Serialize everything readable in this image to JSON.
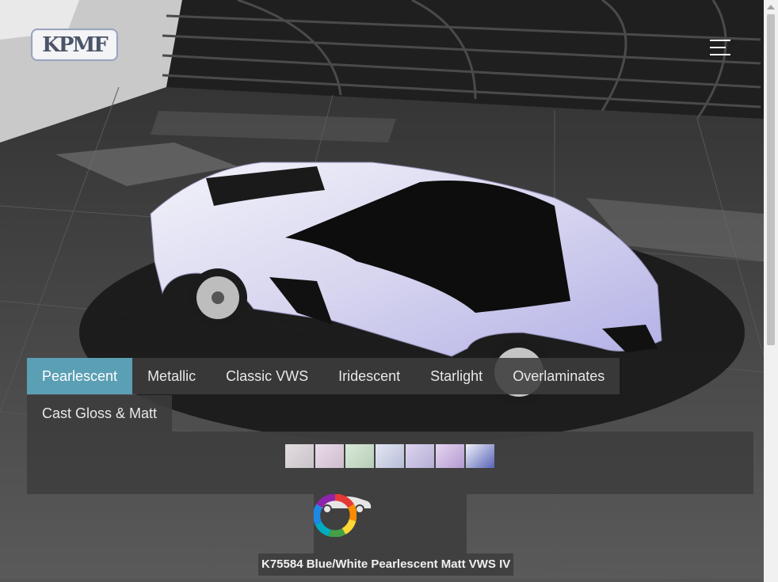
{
  "brand": {
    "logo_text": "KPMF"
  },
  "header": {
    "menu_icon": "hamburger-menu-icon"
  },
  "tabs": [
    {
      "label": "Pearlescent",
      "active": true
    },
    {
      "label": "Metallic",
      "active": false
    },
    {
      "label": "Classic VWS",
      "active": false
    },
    {
      "label": "Iridescent",
      "active": false
    },
    {
      "label": "Starlight",
      "active": false
    },
    {
      "label": "Overlaminates",
      "active": false
    },
    {
      "label": "Cast Gloss & Matt",
      "active": false
    }
  ],
  "swatches": [
    {
      "color_from": "#e4dde0",
      "color_to": "#c9c4c9"
    },
    {
      "color_from": "#eadcea",
      "color_to": "#cdbccd"
    },
    {
      "color_from": "#d8ead8",
      "color_to": "#b8cdb9"
    },
    {
      "color_from": "#e2e6f2",
      "color_to": "#b7bdd6"
    },
    {
      "color_from": "#dcd6ef",
      "color_to": "#b5aed4"
    },
    {
      "color_from": "#e5d6f0",
      "color_to": "#b49ad0"
    },
    {
      "color_from": "#eef0fa",
      "color_to": "#5a64b8"
    }
  ],
  "tools": {
    "car_icon": "car-silhouette-icon",
    "color_wheel_icon": "color-wheel-icon"
  },
  "selected_color": "K75584 Blue/White Pearlescent Matt VWS IV",
  "colors": {
    "accent": "#5b9fb5",
    "panel": "#3e3e3e"
  }
}
